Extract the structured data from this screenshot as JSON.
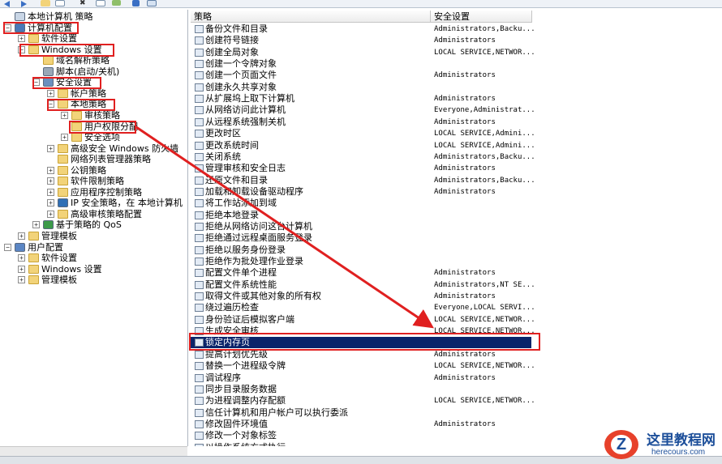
{
  "tree": {
    "items": [
      {
        "label": "本地计算机 策略",
        "level": 0,
        "expander": "",
        "icon": "policy-doc-icon"
      },
      {
        "label": "计算机配置",
        "level": 0,
        "expander": "minus",
        "icon": "computer-icon"
      },
      {
        "label": "软件设置",
        "level": 1,
        "expander": "plus",
        "icon": "folder-icon"
      },
      {
        "label": "Windows 设置",
        "level": 1,
        "expander": "minus",
        "icon": "folder-icon"
      },
      {
        "label": "域名解析策略",
        "level": 2,
        "expander": "",
        "icon": "folder-icon"
      },
      {
        "label": "脚本(启动/关机)",
        "level": 2,
        "expander": "",
        "icon": "script-icon"
      },
      {
        "label": "安全设置",
        "level": 2,
        "expander": "minus",
        "icon": "security-icon"
      },
      {
        "label": "帐户策略",
        "level": 3,
        "expander": "plus",
        "icon": "folder-icon"
      },
      {
        "label": "本地策略",
        "level": 3,
        "expander": "minus",
        "icon": "folder-icon"
      },
      {
        "label": "审核策略",
        "level": 4,
        "expander": "plus",
        "icon": "folder-icon"
      },
      {
        "label": "用户权限分配",
        "level": 4,
        "expander": "",
        "icon": "folder-icon"
      },
      {
        "label": "安全选项",
        "level": 4,
        "expander": "plus",
        "icon": "folder-icon"
      },
      {
        "label": "高级安全 Windows 防火墙",
        "level": 3,
        "expander": "plus",
        "icon": "folder-icon"
      },
      {
        "label": "网络列表管理器策略",
        "level": 3,
        "expander": "",
        "icon": "folder-icon"
      },
      {
        "label": "公钥策略",
        "level": 3,
        "expander": "plus",
        "icon": "folder-icon"
      },
      {
        "label": "软件限制策略",
        "level": 3,
        "expander": "plus",
        "icon": "folder-icon"
      },
      {
        "label": "应用程序控制策略",
        "level": 3,
        "expander": "plus",
        "icon": "folder-icon"
      },
      {
        "label": "IP 安全策略，在 本地计算机",
        "level": 3,
        "expander": "plus",
        "icon": "ipsec-icon"
      },
      {
        "label": "高级审核策略配置",
        "level": 3,
        "expander": "plus",
        "icon": "folder-icon"
      },
      {
        "label": "基于策略的 QoS",
        "level": 2,
        "expander": "plus",
        "icon": "chart-icon"
      },
      {
        "label": "管理模板",
        "level": 1,
        "expander": "plus",
        "icon": "folder-icon"
      },
      {
        "label": "用户配置",
        "level": 0,
        "expander": "minus",
        "icon": "user-icon"
      },
      {
        "label": "软件设置",
        "level": 1,
        "expander": "plus",
        "icon": "folder-icon"
      },
      {
        "label": "Windows 设置",
        "level": 1,
        "expander": "plus",
        "icon": "folder-icon"
      },
      {
        "label": "管理模板",
        "level": 1,
        "expander": "plus",
        "icon": "folder-icon"
      }
    ]
  },
  "list": {
    "columns": [
      "策略",
      "安全设置"
    ],
    "rows": [
      {
        "policy": "备份文件和目录",
        "setting": "Administrators,Backu..."
      },
      {
        "policy": "创建符号链接",
        "setting": "Administrators"
      },
      {
        "policy": "创建全局对象",
        "setting": "LOCAL SERVICE,NETWOR..."
      },
      {
        "policy": "创建一个令牌对象",
        "setting": ""
      },
      {
        "policy": "创建一个页面文件",
        "setting": "Administrators"
      },
      {
        "policy": "创建永久共享对象",
        "setting": ""
      },
      {
        "policy": "从扩展坞上取下计算机",
        "setting": "Administrators"
      },
      {
        "policy": "从网络访问此计算机",
        "setting": "Everyone,Administrat..."
      },
      {
        "policy": "从远程系统强制关机",
        "setting": "Administrators"
      },
      {
        "policy": "更改时区",
        "setting": "LOCAL SERVICE,Admini..."
      },
      {
        "policy": "更改系统时间",
        "setting": "LOCAL SERVICE,Admini..."
      },
      {
        "policy": "关闭系统",
        "setting": "Administrators,Backu..."
      },
      {
        "policy": "管理审核和安全日志",
        "setting": "Administrators"
      },
      {
        "policy": "还原文件和目录",
        "setting": "Administrators,Backu..."
      },
      {
        "policy": "加载和卸载设备驱动程序",
        "setting": "Administrators"
      },
      {
        "policy": "将工作站添加到域",
        "setting": ""
      },
      {
        "policy": "拒绝本地登录",
        "setting": ""
      },
      {
        "policy": "拒绝从网络访问这台计算机",
        "setting": ""
      },
      {
        "policy": "拒绝通过远程桌面服务登录",
        "setting": ""
      },
      {
        "policy": "拒绝以服务身份登录",
        "setting": ""
      },
      {
        "policy": "拒绝作为批处理作业登录",
        "setting": ""
      },
      {
        "policy": "配置文件单个进程",
        "setting": "Administrators"
      },
      {
        "policy": "配置文件系统性能",
        "setting": "Administrators,NT SE..."
      },
      {
        "policy": "取得文件或其他对象的所有权",
        "setting": "Administrators"
      },
      {
        "policy": "绕过遍历检查",
        "setting": "Everyone,LOCAL SERVI..."
      },
      {
        "policy": "身份验证后模拟客户端",
        "setting": "LOCAL SERVICE,NETWOR..."
      },
      {
        "policy": "生成安全审核",
        "setting": "LOCAL SERVICE,NETWOR..."
      },
      {
        "policy": "锁定内存页",
        "setting": ""
      },
      {
        "policy": "提高计划优先级",
        "setting": "Administrators"
      },
      {
        "policy": "替换一个进程级令牌",
        "setting": "LOCAL SERVICE,NETWOR..."
      },
      {
        "policy": "调试程序",
        "setting": "Administrators"
      },
      {
        "policy": "同步目录服务数据",
        "setting": ""
      },
      {
        "policy": "为进程调整内存配额",
        "setting": "LOCAL SERVICE,NETWOR..."
      },
      {
        "policy": "信任计算机和用户帐户可以执行委派",
        "setting": ""
      },
      {
        "policy": "修改固件环境值",
        "setting": "Administrators"
      },
      {
        "policy": "修改一个对象标签",
        "setting": ""
      },
      {
        "policy": "以操作系统方式执行",
        "setting": ""
      }
    ],
    "selected_index": 27
  },
  "watermark": {
    "title": "这里教程网",
    "url": "herecours.com"
  },
  "colors": {
    "selection": "#0a246a",
    "annotation": "#e02020"
  }
}
